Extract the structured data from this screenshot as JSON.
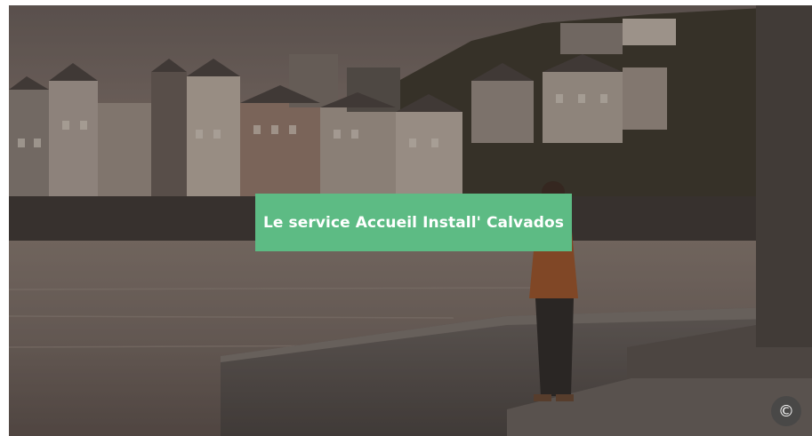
{
  "hero": {
    "cta_label": "Le service Accueil Install' Calvados",
    "cta_color": "#5dbb84",
    "copyright_symbol": "©"
  },
  "icons": {
    "copyright": "copyright-icon"
  }
}
